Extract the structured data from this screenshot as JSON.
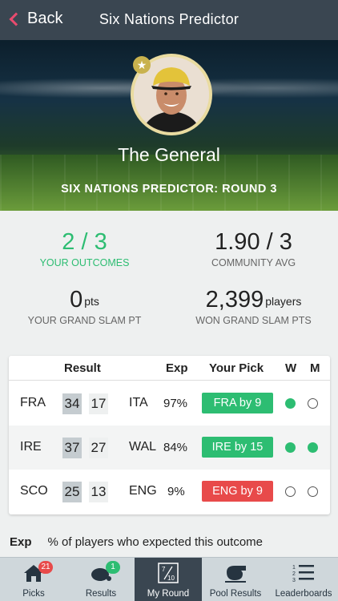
{
  "navbar": {
    "back_label": "Back",
    "title": "Six Nations Predictor"
  },
  "profile": {
    "name": "The General",
    "round_title": "SIX NATIONS PREDICTOR: ROUND 3"
  },
  "stats": {
    "outcomes": {
      "value": "2 / 3",
      "label": "YOUR OUTCOMES"
    },
    "community": {
      "value": "1.90 / 3",
      "label": "COMMUNITY AVG"
    },
    "grand_slam_pts": {
      "value": "0",
      "unit": "pts",
      "label": "YOUR GRAND SLAM PT"
    },
    "players": {
      "value": "2,399",
      "unit": "players",
      "label": "WON GRAND SLAM PTS"
    }
  },
  "table": {
    "headers": {
      "result": "Result",
      "exp": "Exp",
      "pick": "Your Pick",
      "w": "W",
      "m": "M"
    },
    "rows": [
      {
        "home": "FRA",
        "home_score": "34",
        "away_score": "17",
        "away": "ITA",
        "exp": "97%",
        "pick": "FRA by 9",
        "pick_correct": true,
        "w": true,
        "m": false
      },
      {
        "home": "IRE",
        "home_score": "37",
        "away_score": "27",
        "away": "WAL",
        "exp": "84%",
        "pick": "IRE by 15",
        "pick_correct": true,
        "w": true,
        "m": true
      },
      {
        "home": "SCO",
        "home_score": "25",
        "away_score": "13",
        "away": "ENG",
        "exp": "9%",
        "pick": "ENG by 9",
        "pick_correct": false,
        "w": false,
        "m": false
      }
    ]
  },
  "legend": {
    "key": "Exp",
    "text": "% of players who expected this outcome"
  },
  "tabs": [
    {
      "label": "Picks",
      "badge": "21",
      "icon": "house-icon"
    },
    {
      "label": "Results",
      "badge": "1",
      "icon": "rugby-ball-icon"
    },
    {
      "label": "My Round",
      "icon": "fraction-icon",
      "fraction_top": "7",
      "fraction_bottom": "10"
    },
    {
      "label": "Pool Results",
      "icon": "whistle-icon"
    },
    {
      "label": "Leaderboards",
      "icon": "ranked-list-icon",
      "numbers": [
        "1",
        "2",
        "3"
      ]
    }
  ],
  "colors": {
    "green": "#2dbd72",
    "red": "#e84a4a",
    "navbar": "#3a4651",
    "accent_back": "#e84b6e"
  }
}
